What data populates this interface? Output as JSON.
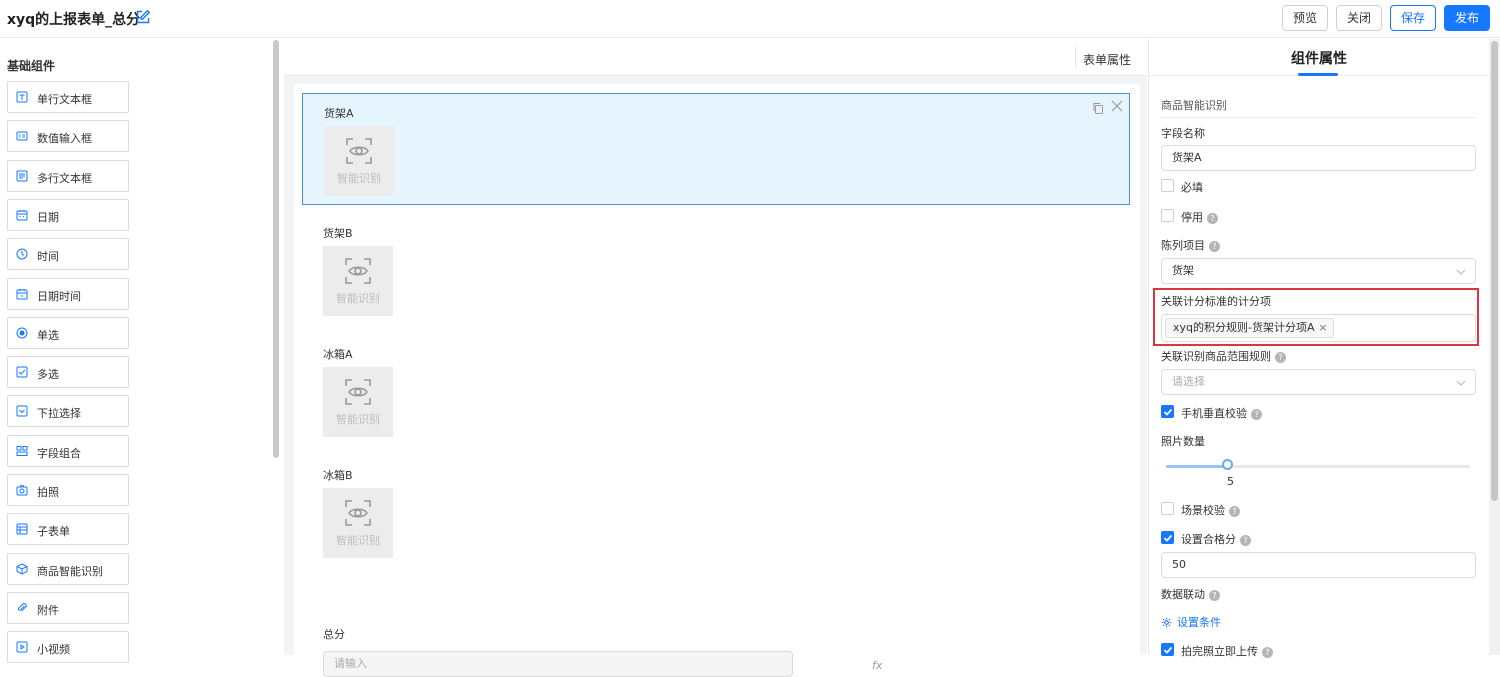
{
  "header": {
    "title": "xyq的上报表单_总分",
    "buttons": {
      "preview": "预览",
      "close": "关闭",
      "save": "保存",
      "publish": "发布"
    },
    "accent_color": "#1677ff"
  },
  "left_panel": {
    "title": "基础组件",
    "components": [
      {
        "label": "单行文本框",
        "icon": "text-icon"
      },
      {
        "label": "数值输入框",
        "icon": "number-icon"
      },
      {
        "label": "多行文本框",
        "icon": "textarea-icon"
      },
      {
        "label": "日期",
        "icon": "calendar-icon"
      },
      {
        "label": "时间",
        "icon": "clock-icon"
      },
      {
        "label": "日期时间",
        "icon": "datetime-icon"
      },
      {
        "label": "单选",
        "icon": "radio-icon"
      },
      {
        "label": "多选",
        "icon": "checkbox-icon"
      },
      {
        "label": "下拉选择",
        "icon": "dropdown-icon"
      },
      {
        "label": "字段组合",
        "icon": "group-icon"
      },
      {
        "label": "拍照",
        "icon": "camera-icon"
      },
      {
        "label": "子表单",
        "icon": "subform-icon"
      },
      {
        "label": "商品智能识别",
        "icon": "cube-icon"
      },
      {
        "label": "附件",
        "icon": "paperclip-icon"
      },
      {
        "label": "小视频",
        "icon": "video-icon"
      }
    ]
  },
  "center": {
    "tab_label": "表单属性",
    "fields": [
      {
        "label": "货架A",
        "widget_text": "智能识别",
        "selected": true
      },
      {
        "label": "货架B",
        "widget_text": "智能识别",
        "selected": false
      },
      {
        "label": "冰箱A",
        "widget_text": "智能识别",
        "selected": false
      },
      {
        "label": "冰箱B",
        "widget_text": "智能识别",
        "selected": false
      }
    ],
    "total": {
      "label": "总分",
      "placeholder": "请输入",
      "fx_label": "fx"
    }
  },
  "properties": {
    "tab_title": "组件属性",
    "section": "商品智能识别",
    "field_name_label": "字段名称",
    "field_name_value": "货架A",
    "required_label": "必填",
    "disabled_label": "停用",
    "display_item_label": "陈列项目",
    "display_item_value": "货架",
    "scoring_label": "关联计分标准的计分项",
    "scoring_tag": "xyq的积分规则-货架计分项A",
    "scope_rule_label": "关联识别商品范围规则",
    "scope_rule_placeholder": "请选择",
    "vertical_check_label": "手机垂直校验",
    "vertical_check_checked": true,
    "photo_count_label": "照片数量",
    "photo_count_value": "5",
    "photo_count_fraction": 0.2,
    "scene_check_label": "场景校验",
    "scene_check_checked": false,
    "pass_score_label": "设置合格分",
    "pass_score_checked": true,
    "pass_score_value": "50",
    "data_link_label": "数据联动",
    "set_condition_label": "设置条件",
    "upload_label": "拍完照立即上传",
    "upload_checked": true,
    "highlight_color": "#d9363e"
  }
}
